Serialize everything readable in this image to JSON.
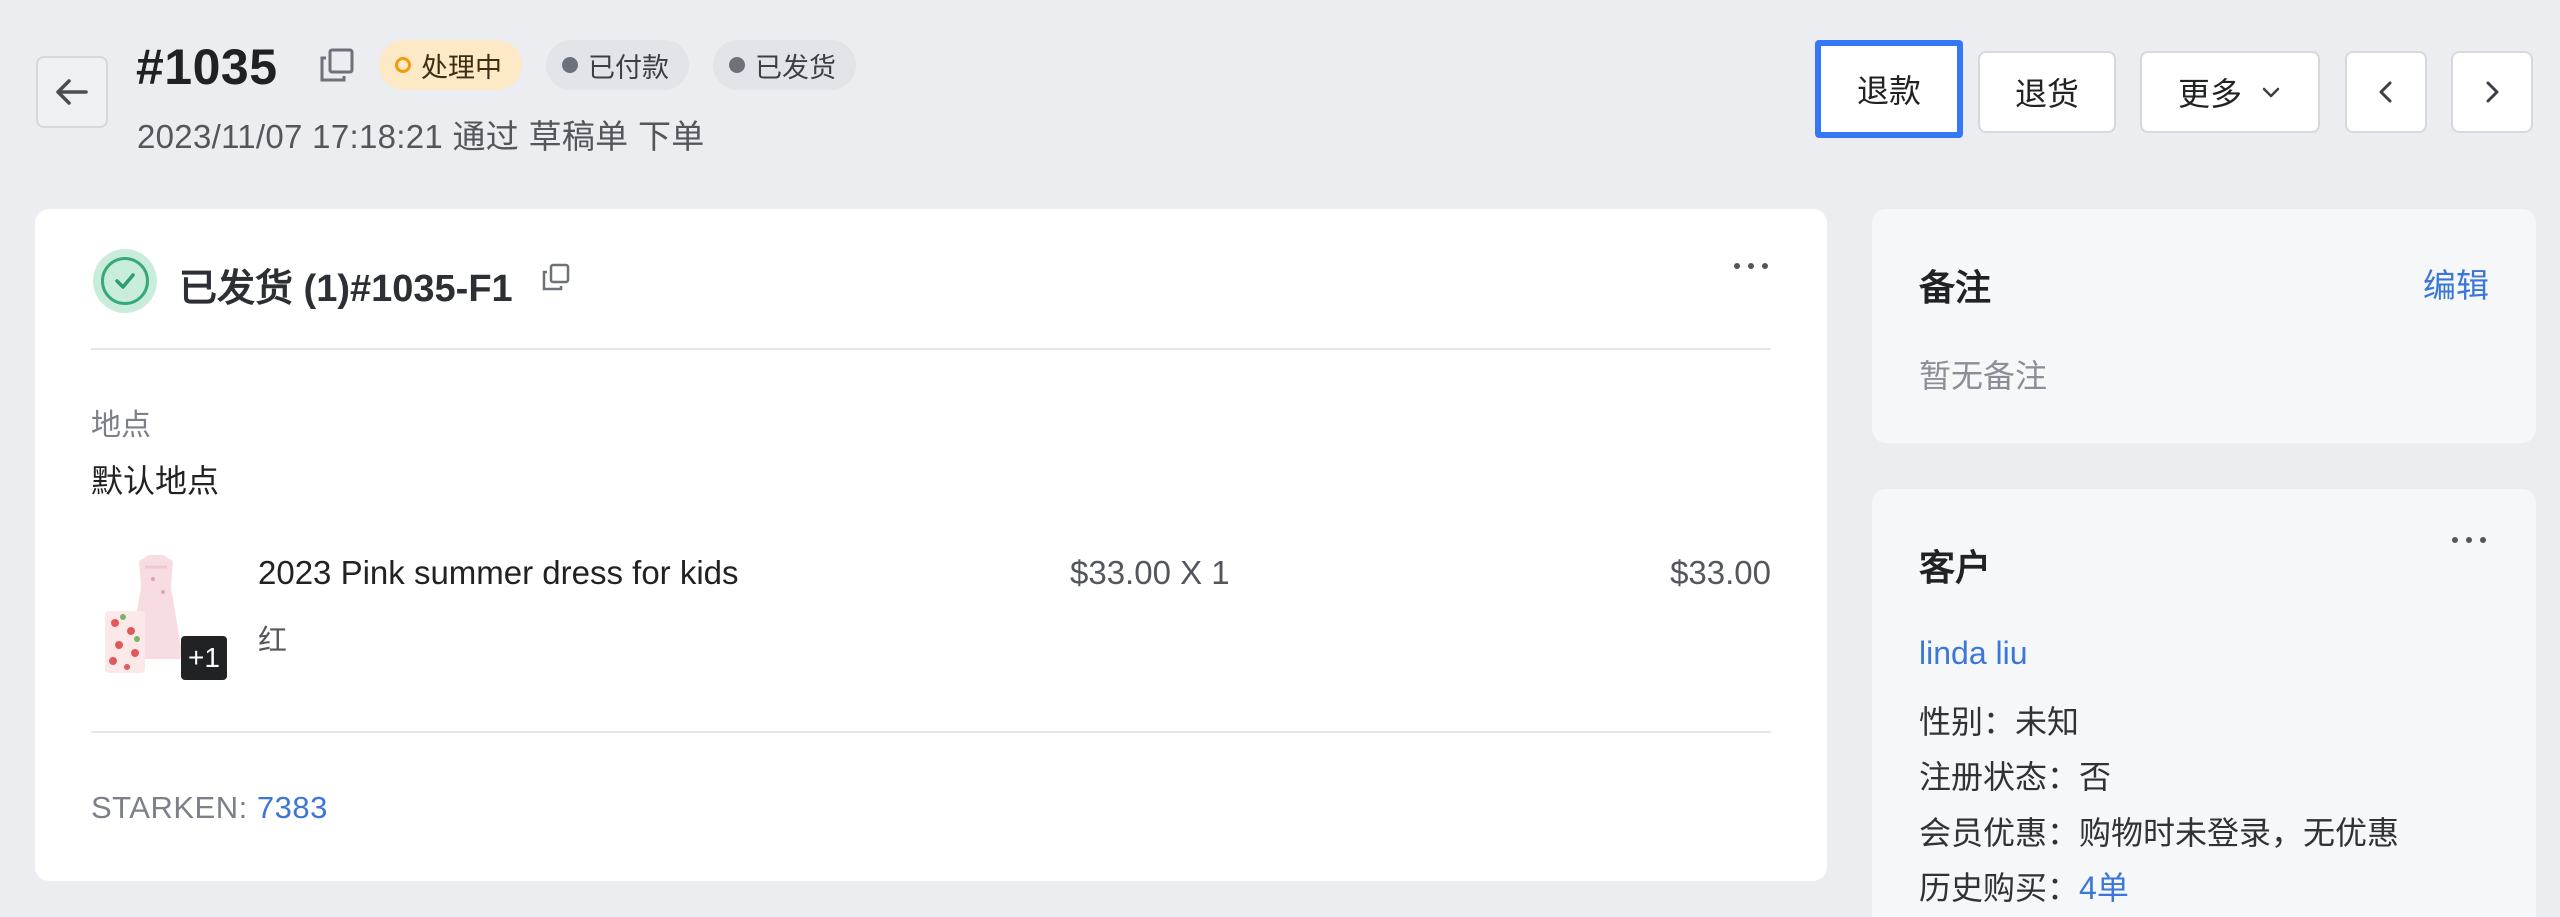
{
  "header": {
    "order_number": "#1035",
    "badges": {
      "processing": "处理中",
      "paid": "已付款",
      "shipped": "已发货"
    },
    "subtitle": "2023/11/07 17:18:21 通过 草稿单 下单",
    "buttons": {
      "refund": "退款",
      "return": "退货",
      "more": "更多"
    },
    "colors": {
      "processing_bg": "#fde9c6",
      "processing_dot": "#f39a0d",
      "focus_ring": "#3578f6"
    }
  },
  "fulfillment": {
    "title": "已发货 (1)#1035-F1",
    "location_label": "地点",
    "location_value": "默认地点",
    "item": {
      "name": "2023 Pink summer dress for kids",
      "variant": "红",
      "unit_price": "$33.00 X 1",
      "total": "$33.00",
      "extra_count": "+1"
    },
    "tracking_label": "STARKEN:",
    "tracking_number": "7383",
    "status_color": "#37a87a"
  },
  "notes": {
    "title": "备注",
    "edit": "编辑",
    "empty": "暂无备注"
  },
  "customer": {
    "title": "客户",
    "name": "linda liu",
    "gender_label": "性别：",
    "gender_value": "未知",
    "register_label": "注册状态：",
    "register_value": "否",
    "member_label": "会员优惠：",
    "member_value": "购物时未登录，无优惠",
    "history_label": "历史购买：",
    "history_value": "4单"
  },
  "icons": [
    "back-arrow-icon",
    "copy-icon",
    "chevron-down-icon",
    "chevron-left-icon",
    "chevron-right-icon",
    "check-icon",
    "more-horizontal-icon"
  ],
  "link_color": "#3b76d9"
}
